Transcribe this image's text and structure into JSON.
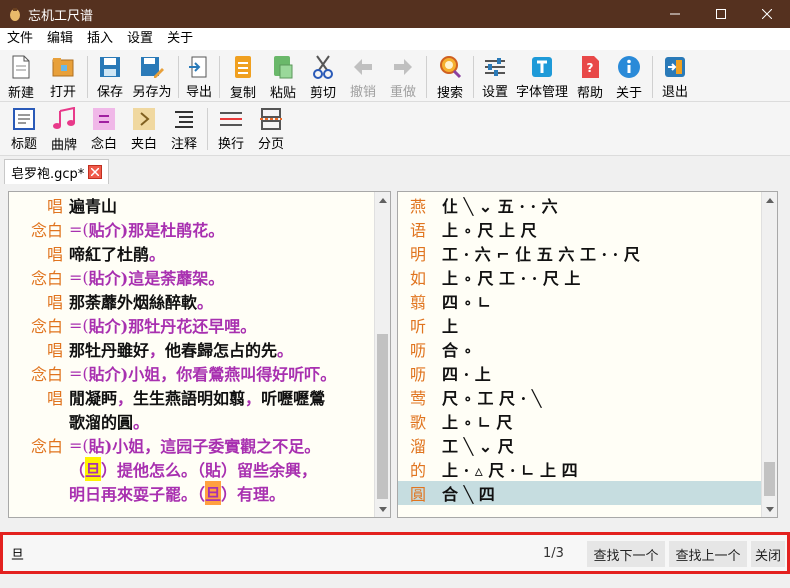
{
  "window": {
    "title": "忘机工尺谱",
    "icon": "app-icon"
  },
  "menu": [
    "文件",
    "编辑",
    "插入",
    "设置",
    "关于"
  ],
  "toolbar1": [
    {
      "label": "新建",
      "icon": "new-file-icon",
      "disabled": false
    },
    {
      "label": "打开",
      "icon": "open-folder-icon",
      "disabled": false
    },
    {
      "label": "保存",
      "icon": "save-icon",
      "disabled": false
    },
    {
      "label": "另存为",
      "icon": "save-as-icon",
      "disabled": false
    },
    {
      "label": "导出",
      "icon": "export-icon",
      "disabled": false
    },
    {
      "label": "复制",
      "icon": "copy-icon",
      "disabled": false
    },
    {
      "label": "粘贴",
      "icon": "paste-icon",
      "disabled": false
    },
    {
      "label": "剪切",
      "icon": "scissors-icon",
      "disabled": false
    },
    {
      "label": "撤销",
      "icon": "undo-icon",
      "disabled": true
    },
    {
      "label": "重做",
      "icon": "redo-icon",
      "disabled": true
    },
    {
      "label": "搜索",
      "icon": "search-icon",
      "disabled": false
    },
    {
      "label": "设置",
      "icon": "settings-sliders-icon",
      "disabled": false
    },
    {
      "label": "字体管理",
      "icon": "font-icon",
      "disabled": false
    },
    {
      "label": "帮助",
      "icon": "help-icon",
      "disabled": false
    },
    {
      "label": "关于",
      "icon": "info-icon",
      "disabled": false
    },
    {
      "label": "退出",
      "icon": "exit-icon",
      "disabled": false
    }
  ],
  "toolbar2": [
    {
      "label": "标题",
      "icon": "title-icon"
    },
    {
      "label": "曲牌",
      "icon": "music-note-icon"
    },
    {
      "label": "念白",
      "icon": "equals-icon"
    },
    {
      "label": "夹白",
      "icon": "chevron-right-icon"
    },
    {
      "label": "注释",
      "icon": "comment-lines-icon"
    },
    {
      "label": "换行",
      "icon": "line-break-icon"
    },
    {
      "label": "分页",
      "icon": "page-break-icon"
    }
  ],
  "tab": {
    "label": "皂罗袍.gcp*"
  },
  "left_lines": [
    {
      "role": "唱",
      "segments": [
        {
          "t": "遍青山",
          "c": "black"
        }
      ]
    },
    {
      "role": "念白",
      "segments": [
        {
          "t": "=(",
          "c": "prefix"
        },
        {
          "t": "贴介)那是杜鹃花。",
          "c": "purple"
        }
      ]
    },
    {
      "role": "唱",
      "segments": [
        {
          "t": "啼紅了杜鹃",
          "c": "black"
        },
        {
          "t": "。",
          "c": "purple"
        }
      ]
    },
    {
      "role": "念白",
      "segments": [
        {
          "t": "=(",
          "c": "prefix"
        },
        {
          "t": "貼介)這是荼蘼架。",
          "c": "purple"
        }
      ]
    },
    {
      "role": "唱",
      "segments": [
        {
          "t": "那荼蘼外烟絲醉軟",
          "c": "black"
        },
        {
          "t": "。",
          "c": "purple"
        }
      ]
    },
    {
      "role": "念白",
      "segments": [
        {
          "t": "=(",
          "c": "prefix"
        },
        {
          "t": "貼介)那牡丹花还早哩。",
          "c": "purple"
        }
      ]
    },
    {
      "role": "唱",
      "segments": [
        {
          "t": "那牡丹雖好",
          "c": "black"
        },
        {
          "t": "，",
          "c": "purple"
        },
        {
          "t": "他春歸怎占的先",
          "c": "black"
        },
        {
          "t": "。",
          "c": "purple"
        }
      ]
    },
    {
      "role": "念白",
      "segments": [
        {
          "t": "=(",
          "c": "prefix"
        },
        {
          "t": "貼介)小姐，你看鶯燕叫得好听吓。",
          "c": "purple"
        }
      ]
    },
    {
      "role": "唱",
      "segments": [
        {
          "t": "閒凝眄",
          "c": "black"
        },
        {
          "t": "，",
          "c": "purple"
        },
        {
          "t": "生生燕語明如翦",
          "c": "black"
        },
        {
          "t": "，",
          "c": "purple"
        },
        {
          "t": "听嚦嚦鶯",
          "c": "black"
        }
      ]
    },
    {
      "role": "",
      "segments": [
        {
          "t": "歌溜的圓",
          "c": "black"
        },
        {
          "t": "。",
          "c": "purple"
        }
      ]
    },
    {
      "role": "念白",
      "segments": [
        {
          "t": "=(",
          "c": "prefix"
        },
        {
          "t": "貼)小姐，這园子委實觀之不足。",
          "c": "purple"
        }
      ]
    },
    {
      "role": "",
      "segments": [
        {
          "t": "（",
          "c": "purple"
        },
        {
          "t": "旦",
          "c": "purple",
          "hl": "yellow"
        },
        {
          "t": "）提他怎么。（貼）留些余興，",
          "c": "purple"
        }
      ]
    },
    {
      "role": "",
      "segments": [
        {
          "t": "明日再來耍子罷。（",
          "c": "purple"
        },
        {
          "t": "旦",
          "c": "purple",
          "hl": "orange"
        },
        {
          "t": "）有理。",
          "c": "purple"
        }
      ]
    }
  ],
  "right_lines": [
    {
      "char": "燕",
      "notes": "仩 ╲ ⌄ 五 · · 六"
    },
    {
      "char": "语",
      "notes": "上 ∘ 尺 上 尺"
    },
    {
      "char": "明",
      "notes": "工 · 六 ⌐ 仩 五 六 工 · · 尺"
    },
    {
      "char": "如",
      "notes": "上 ∘ 尺 工 · · 尺 上"
    },
    {
      "char": "翦",
      "notes": "四 ∘ ∟"
    },
    {
      "char": "听",
      "notes": "上"
    },
    {
      "char": "呖",
      "notes": "合 ∘"
    },
    {
      "char": "呖",
      "notes": "四 · 上"
    },
    {
      "char": "莺",
      "notes": "尺 ∘ 工 尺 · ╲"
    },
    {
      "char": "歌",
      "notes": "上 ∘ ∟ 尺"
    },
    {
      "char": "溜",
      "notes": "工 ╲ ⌄ 尺"
    },
    {
      "char": "的",
      "notes": "上 · ▵ 尺 · ∟ 上 四"
    },
    {
      "char": "圓",
      "notes": "合 ╲ 四",
      "selected": true
    }
  ],
  "find": {
    "query": "旦",
    "count": "1/3",
    "next": "查找下一个",
    "prev": "查找上一个",
    "close": "关闭"
  }
}
